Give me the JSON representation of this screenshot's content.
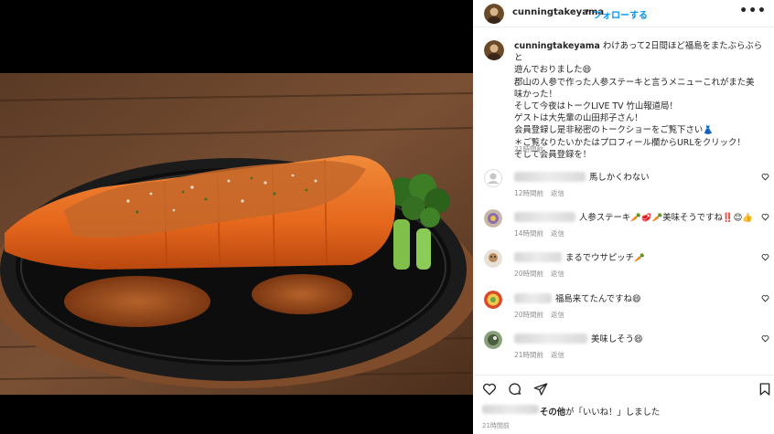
{
  "post": {
    "username": "cunningtakeyama",
    "dot": "•",
    "follow_label": "フォローする",
    "more_label": "•••",
    "caption_lines": [
      "わけあって2日間ほど福島をまたぶらぶらと",
      "遊んでおりました😄",
      "郡山の人参で作った人参ステーキと言うメニューこれがまた美",
      "味かった！",
      "そして今夜はトークLIVE TV 竹山報道局！",
      "ゲストは大先輩の山田邦子さん！",
      "会員登録し是非秘密のトークショーをご覧下さい👗",
      "＊ご覧なりたいかたはプロフィール欄からURLをクリック！",
      "そして会員登録を！"
    ],
    "caption_time": "21時間前"
  },
  "comments": [
    {
      "text": "馬しかくわない",
      "time": "12時間前",
      "reply": "返信"
    },
    {
      "text": "人参ステーキ🥕🥩🥕美味そうですね‼️😊👍",
      "time": "14時間前",
      "reply": "返信"
    },
    {
      "text": "まるでウサピッチ🥕",
      "time": "20時間前",
      "reply": "返信"
    },
    {
      "text": "福島来てたんですね😄",
      "time": "20時間前",
      "reply": "返信"
    },
    {
      "text": "美味しそう😄",
      "time": "21時間前",
      "reply": "返信"
    }
  ],
  "likes": {
    "bold": "その他",
    "rest": "が「いいね！」しました"
  },
  "post_time": "21時間前",
  "colors": {
    "accent": "#0095f6",
    "meta": "#8e8e8e",
    "text": "#262626"
  },
  "icons": [
    "heart-icon",
    "comment-icon",
    "share-icon",
    "bookmark-icon",
    "more-icon"
  ]
}
